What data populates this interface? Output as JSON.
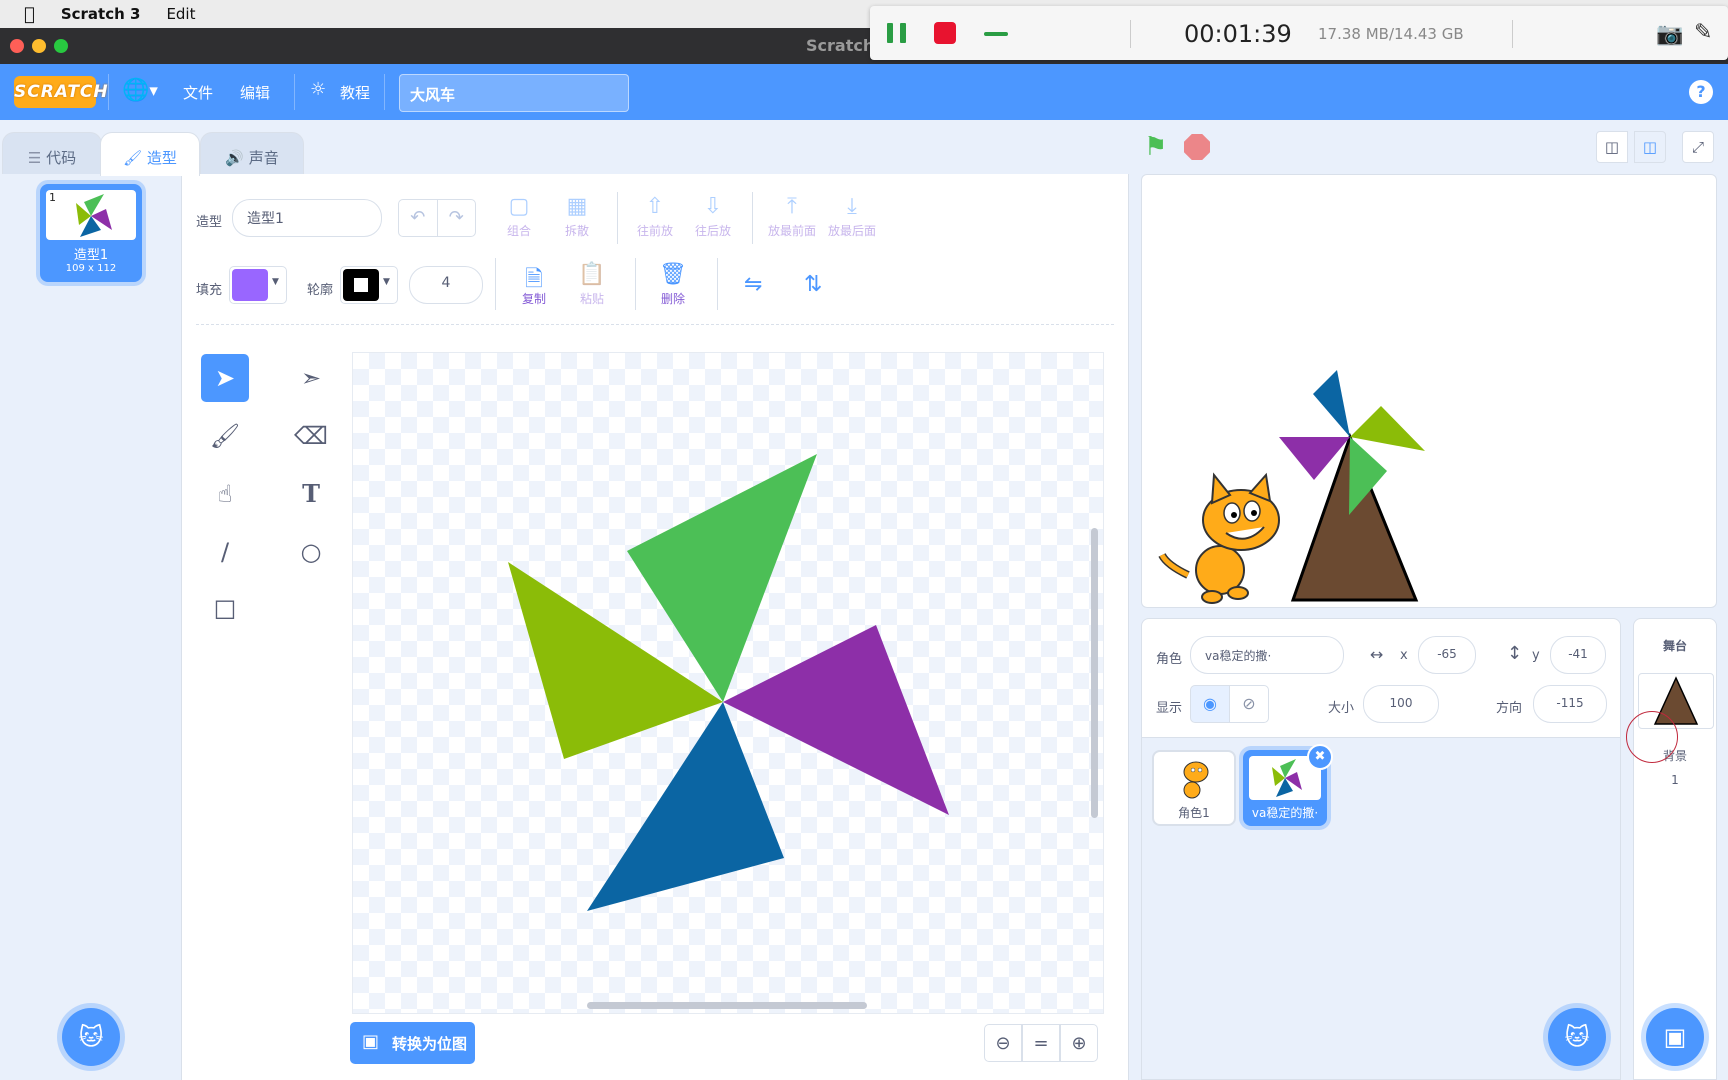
{
  "macbar": {
    "apple": "",
    "app": "Scratch 3",
    "menu": "Edit"
  },
  "window": {
    "title": "Scratch"
  },
  "recorder": {
    "time": "00:01:39",
    "size": "17.38 MB/14.43 GB"
  },
  "menubar": {
    "logo": "SCRATCH",
    "file": "文件",
    "edit": "编辑",
    "tutorials": "教程",
    "project_title": "大风车",
    "help": "?"
  },
  "tabs": {
    "code": "代码",
    "costumes": "造型",
    "sounds": "声音"
  },
  "costumes": [
    {
      "number": "1",
      "name": "造型1",
      "size": "109 x 112"
    }
  ],
  "paint": {
    "costume_label": "造型",
    "costume_name": "造型1",
    "group": "组合",
    "ungroup": "拆散",
    "forward": "往前放",
    "backward": "往后放",
    "front": "放最前面",
    "back": "放最后面",
    "fill_label": "填充",
    "fill_color": "#9966ff",
    "outline_label": "轮廓",
    "outline_color": "#000000",
    "outline_width": "4",
    "copy": "复制",
    "paste": "粘贴",
    "delete": "删除",
    "convert_bitmap": "转换为位图",
    "blade_colors": [
      "#4cbf56",
      "#8bbc08",
      "#8d2fa8",
      "#0b65a3"
    ]
  },
  "sprite": {
    "label": "角色",
    "name": "va稳定的撒·",
    "x_label": "x",
    "x": "-65",
    "y_label": "y",
    "y": "-41",
    "show_label": "显示",
    "size_label": "大小",
    "size": "100",
    "direction_label": "方向",
    "direction": "-115"
  },
  "sprites": [
    {
      "name": "角色1"
    },
    {
      "name": "va稳定的撒·"
    }
  ],
  "stage_panel": {
    "title": "舞台",
    "backdrop_label": "背景",
    "backdrop_count": "1"
  }
}
